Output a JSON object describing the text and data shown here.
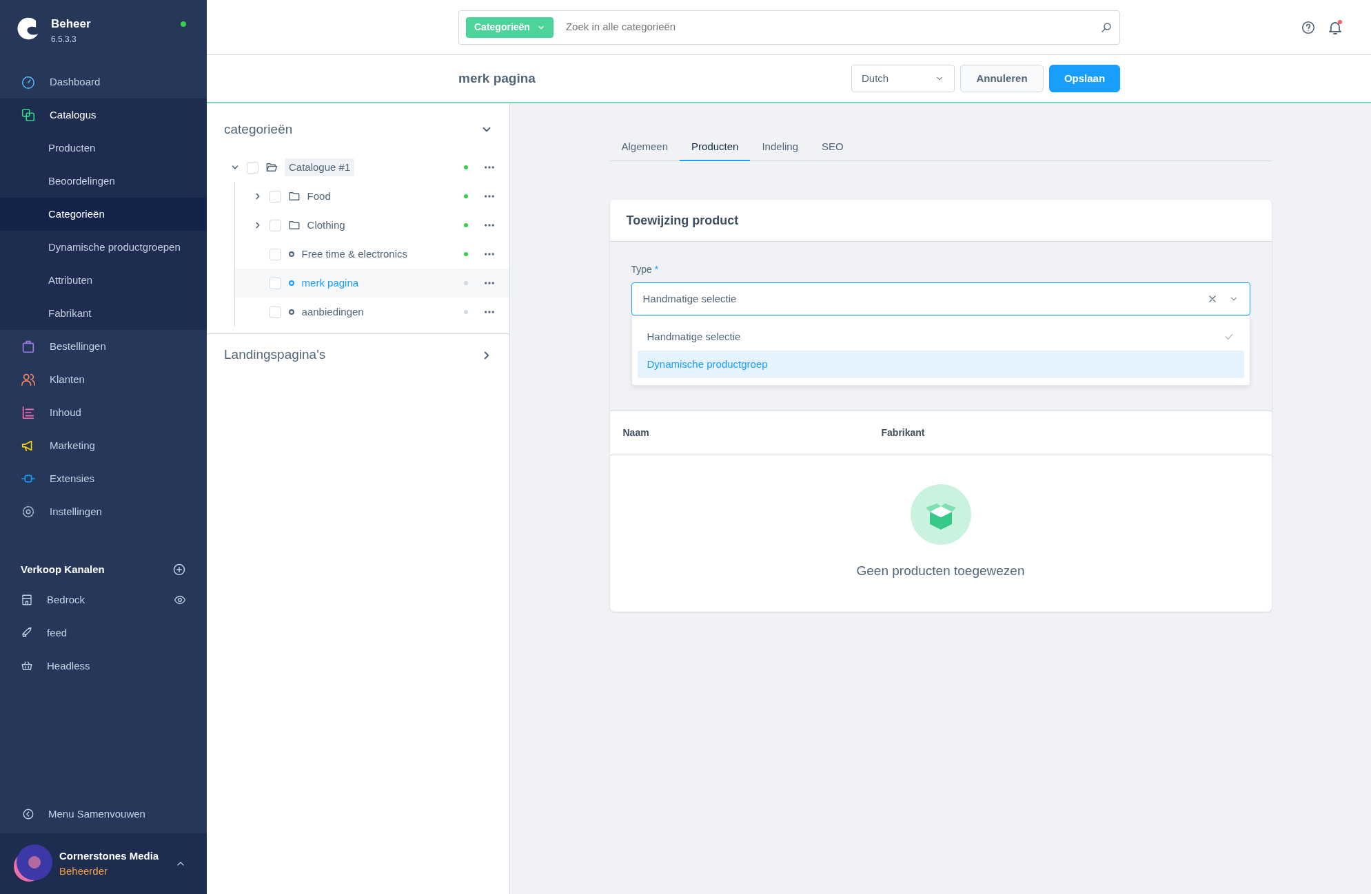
{
  "sidebar": {
    "brand": {
      "title": "Beheer",
      "version": "6.5.3.3",
      "online": true
    },
    "nav": [
      {
        "label": "Dashboard",
        "expanded": false
      },
      {
        "label": "Catalogus",
        "expanded": true,
        "children": [
          {
            "label": "Producten",
            "selected": false
          },
          {
            "label": "Beoordelingen",
            "selected": false
          },
          {
            "label": "Categorieën",
            "selected": true
          },
          {
            "label": "Dynamische productgroepen",
            "selected": false
          },
          {
            "label": "Attributen",
            "selected": false
          },
          {
            "label": "Fabrikant",
            "selected": false
          }
        ]
      },
      {
        "label": "Bestellingen",
        "expanded": false
      },
      {
        "label": "Klanten",
        "expanded": false
      },
      {
        "label": "Inhoud",
        "expanded": false
      },
      {
        "label": "Marketing",
        "expanded": false
      },
      {
        "label": "Extensies",
        "expanded": false
      },
      {
        "label": "Instellingen",
        "expanded": false
      }
    ],
    "channels_title": "Verkoop Kanalen",
    "channels": [
      {
        "label": "Bedrock",
        "visible": true
      },
      {
        "label": "feed",
        "visible": false
      },
      {
        "label": "Headless",
        "visible": false
      }
    ],
    "collapse": "Menu Samenvouwen",
    "user": {
      "name": "Cornerstones Media",
      "role": "Beheerder"
    }
  },
  "search": {
    "scope": "Categorieën",
    "placeholder": "Zoek in alle categorieën"
  },
  "header": {
    "title": "merk pagina",
    "language": "Dutch",
    "buttons": [
      "Annuleren",
      "Opslaan"
    ]
  },
  "tree_panel": {
    "title": "categorieën",
    "expanded": true,
    "tree": [
      {
        "label": "Catalogue #1",
        "kind": "folder",
        "expanded": true,
        "active": true,
        "selected": false,
        "children": [
          {
            "label": "Food",
            "kind": "folder",
            "expanded": false,
            "active": true,
            "selected": false
          },
          {
            "label": "Clothing",
            "kind": "folder",
            "expanded": false,
            "active": true,
            "selected": false
          },
          {
            "label": "Free time & electronics",
            "kind": "leaf",
            "active": true,
            "selected": false
          },
          {
            "label": "merk pagina",
            "kind": "leaf",
            "active": false,
            "selected": true
          },
          {
            "label": "aanbiedingen",
            "kind": "leaf",
            "active": false,
            "selected": false
          }
        ]
      }
    ],
    "landing": "Landingspagina's"
  },
  "tabs": [
    {
      "label": "Algemeen",
      "selected": false
    },
    {
      "label": "Producten",
      "selected": true
    },
    {
      "label": "Indeling",
      "selected": false
    },
    {
      "label": "SEO",
      "selected": false
    }
  ],
  "card": {
    "title": "Toewijzing product",
    "type_label": "Type",
    "required_mark": "*",
    "value": "Handmatige selectie",
    "options": [
      {
        "label": "Handmatige selectie",
        "checked": true,
        "highlighted": false
      },
      {
        "label": "Dynamische productgroep",
        "checked": false,
        "highlighted": true
      }
    ],
    "columns": [
      "Naam",
      "Fabrikant"
    ],
    "empty": "Geen producten toegewezen"
  }
}
